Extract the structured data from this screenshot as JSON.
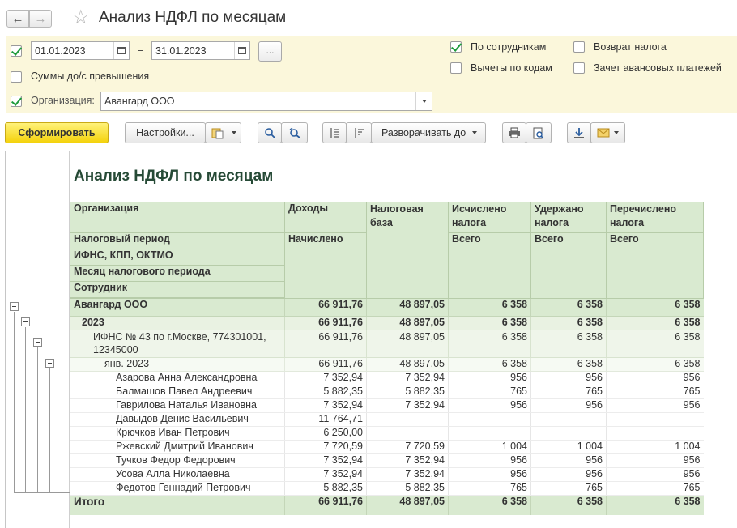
{
  "window": {
    "title": "Анализ НДФЛ по месяцам",
    "back_icon": "←",
    "forward_icon": "→",
    "favorite_icon": "☆"
  },
  "settings": {
    "date_from": "01.01.2023",
    "date_dash": "–",
    "date_to": "31.01.2023",
    "dots_label": "...",
    "sums_over_threshold": {
      "label": "Суммы до/с превышения",
      "checked": false
    },
    "organization": {
      "label": "Организация:",
      "checked": true,
      "value": "Авангард ООО"
    },
    "period_checked": true,
    "by_employees": {
      "label": "По сотрудникам",
      "checked": true
    },
    "deductions_by_codes": {
      "label": "Вычеты по кодам",
      "checked": false
    },
    "tax_refund": {
      "label": "Возврат налога",
      "checked": false
    },
    "advance_offset": {
      "label": "Зачет авансовых платежей",
      "checked": false
    }
  },
  "toolbar": {
    "generate_label": "Сформировать",
    "settings_label": "Настройки...",
    "expand_label": "Разворачивать до"
  },
  "report": {
    "title": "Анализ НДФЛ по месяцам",
    "headers": {
      "organization": "Организация",
      "tax_period": "Налоговый период",
      "ifns": "ИФНС, КПП, ОКТМО",
      "month": "Месяц налогового периода",
      "employee": "Сотрудник",
      "income": "Доходы",
      "income_sub": "Начислено",
      "tax_base": "Налоговая база",
      "calculated": "Исчислено налога",
      "calculated_sub": "Всего",
      "withheld": "Удержано налога",
      "withheld_sub": "Всего",
      "transferred": "Перечислено налога",
      "transferred_sub": "Всего"
    },
    "org_row": {
      "name": "Авангард ООО",
      "income": "66 911,76",
      "base": "48 897,05",
      "calc": "6 358",
      "withheld": "6 358",
      "transferred": "6 358"
    },
    "year_row": {
      "name": "2023",
      "income": "66 911,76",
      "base": "48 897,05",
      "calc": "6 358",
      "withheld": "6 358",
      "transferred": "6 358"
    },
    "ifns_row": {
      "name_line1": "ИФНС № 43 по г.Москве, 774301001,",
      "name_line2": "12345000",
      "income": "66 911,76",
      "base": "48 897,05",
      "calc": "6 358",
      "withheld": "6 358",
      "transferred": "6 358"
    },
    "month_row": {
      "name": "янв. 2023",
      "income": "66 911,76",
      "base": "48 897,05",
      "calc": "6 358",
      "withheld": "6 358",
      "transferred": "6 358"
    },
    "employees": [
      {
        "name": "Азарова Анна Александровна",
        "income": "7 352,94",
        "base": "7 352,94",
        "calc": "956",
        "withheld": "956",
        "transferred": "956"
      },
      {
        "name": "Балмашов Павел Андреевич",
        "income": "5 882,35",
        "base": "5 882,35",
        "calc": "765",
        "withheld": "765",
        "transferred": "765"
      },
      {
        "name": "Гаврилова Наталья Ивановна",
        "income": "7 352,94",
        "base": "7 352,94",
        "calc": "956",
        "withheld": "956",
        "transferred": "956"
      },
      {
        "name": "Давыдов Денис Васильевич",
        "income": "11 764,71",
        "base": "",
        "calc": "",
        "withheld": "",
        "transferred": ""
      },
      {
        "name": "Крючков Иван Петрович",
        "income": "6 250,00",
        "base": "",
        "calc": "",
        "withheld": "",
        "transferred": ""
      },
      {
        "name": "Ржевский Дмитрий Иванович",
        "income": "7 720,59",
        "base": "7 720,59",
        "calc": "1 004",
        "withheld": "1 004",
        "transferred": "1 004"
      },
      {
        "name": "Тучков Федор Федорович",
        "income": "7 352,94",
        "base": "7 352,94",
        "calc": "956",
        "withheld": "956",
        "transferred": "956"
      },
      {
        "name": "Усова Алла Николаевна",
        "income": "7 352,94",
        "base": "7 352,94",
        "calc": "956",
        "withheld": "956",
        "transferred": "956"
      },
      {
        "name": "Федотов Геннадий Петрович",
        "income": "5 882,35",
        "base": "5 882,35",
        "calc": "765",
        "withheld": "765",
        "transferred": "765"
      }
    ],
    "total_row": {
      "name": "Итого",
      "income": "66 911,76",
      "base": "48 897,05",
      "calc": "6 358",
      "withheld": "6 358",
      "transferred": "6 358"
    }
  }
}
